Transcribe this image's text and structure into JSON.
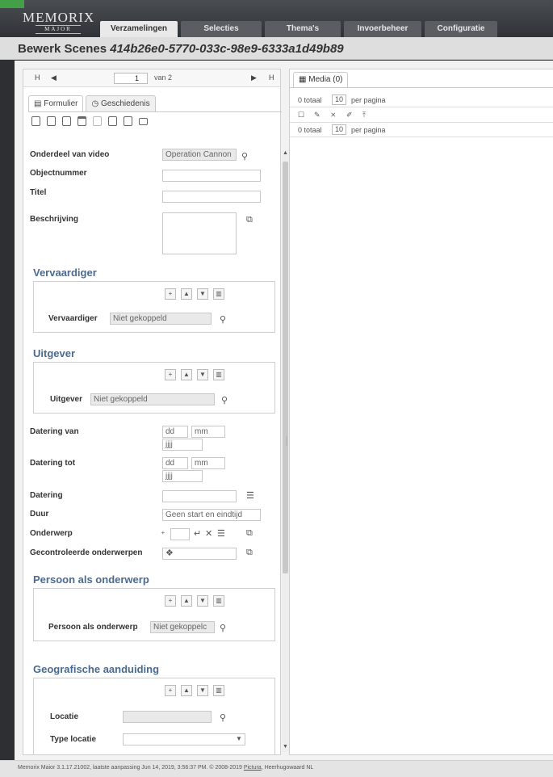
{
  "app": {
    "logo_main": "MEMORIX",
    "logo_sub": "MAJOR"
  },
  "tabs": [
    {
      "label": "Verzamelingen",
      "active": true
    },
    {
      "label": "Selecties"
    },
    {
      "label": "Thema's"
    },
    {
      "label": "Invoerbeheer"
    },
    {
      "label": "Configuratie"
    }
  ],
  "title": {
    "prefix": "Bewerk Scenes",
    "id": "414b26e0-5770-033c-98e9-6333a1d49b89"
  },
  "pager": {
    "first": "H",
    "prev": "◀",
    "page": "1",
    "of": "van 2",
    "next": "▶",
    "last": "H"
  },
  "subtabs": {
    "form": "Formulier",
    "history": "Geschiedenis"
  },
  "fields": {
    "onderdeel_label": "Onderdeel van video",
    "onderdeel_value": "Operation Cannon",
    "objectnummer_label": "Objectnummer",
    "titel_label": "Titel",
    "beschrijving_label": "Beschrijving",
    "datering_van_label": "Datering van",
    "datering_tot_label": "Datering tot",
    "dd": "dd",
    "mm": "mm",
    "jjjj": "jjjj",
    "datering_label": "Datering",
    "duur_label": "Duur",
    "duur_value": "Geen start en eindtijd",
    "onderwerp_label": "Onderwerp",
    "gecontroleerde_label": "Gecontroleerde onderwerpen"
  },
  "sections": {
    "vervaardiger": {
      "title": "Vervaardiger",
      "field": "Vervaardiger",
      "value": "Niet gekoppeld"
    },
    "uitgever": {
      "title": "Uitgever",
      "field": "Uitgever",
      "value": "Niet gekoppeld"
    },
    "persoon": {
      "title": "Persoon als onderwerp",
      "field": "Persoon als onderwerp",
      "value": "Niet gekoppelc"
    },
    "geo": {
      "title": "Geografische aanduiding",
      "locatie": "Locatie",
      "type_locatie": "Type locatie"
    }
  },
  "media": {
    "tab": "Media (0)",
    "total": "0 totaal",
    "per_page_value": "10",
    "per_page_label": "per pagina"
  },
  "footer": {
    "text": "Memorix Maior 3.1.17.21002, laatste aanpassing Jun 14, 2019, 3:56:37 PM. © 2008-2019",
    "link": "Pictura",
    "suffix": ", Heerhugowaard NL"
  }
}
